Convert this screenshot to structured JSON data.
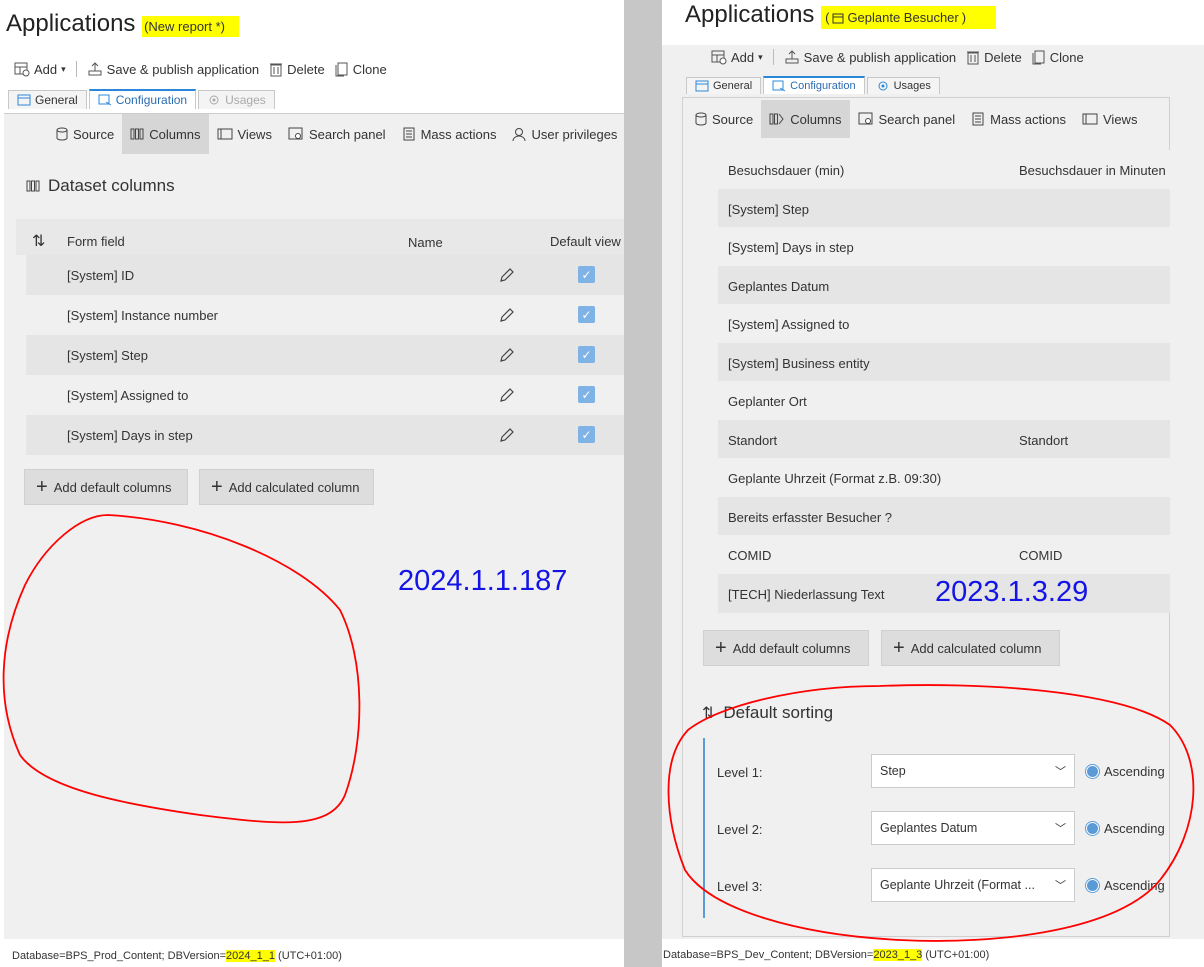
{
  "left": {
    "title": "Applications",
    "subtitle": "(New report *)",
    "toolbar": {
      "add": "Add",
      "save": "Save & publish application",
      "delete": "Delete",
      "clone": "Clone"
    },
    "tabs": {
      "general": "General",
      "configuration": "Configuration",
      "usages": "Usages"
    },
    "subnav": {
      "source": "Source",
      "columns": "Columns",
      "views": "Views",
      "search_panel": "Search panel",
      "mass_actions": "Mass actions",
      "user_privileges": "User privileges"
    },
    "section_title": "Dataset columns",
    "headers": {
      "form_field": "Form field",
      "name": "Name",
      "default_view": "Default view"
    },
    "rows": [
      {
        "field": "[System] ID"
      },
      {
        "field": "[System] Instance number"
      },
      {
        "field": "[System] Step"
      },
      {
        "field": "[System] Assigned to"
      },
      {
        "field": "[System] Days in step"
      }
    ],
    "buttons": {
      "add_default": "Add default columns",
      "add_calculated": "Add calculated column"
    },
    "version": "2024.1.1.187",
    "status": {
      "prefix": "Database=BPS_Prod_Content; DBVersion=",
      "db_version": "2024_1_1",
      "suffix": " (UTC+01:00)"
    }
  },
  "right": {
    "title": "Applications",
    "subtitle": "Geplante Besucher",
    "toolbar": {
      "add": "Add",
      "save": "Save & publish application",
      "delete": "Delete",
      "clone": "Clone"
    },
    "tabs": {
      "general": "General",
      "configuration": "Configuration",
      "usages": "Usages"
    },
    "subnav": {
      "source": "Source",
      "columns": "Columns",
      "search_panel": "Search panel",
      "mass_actions": "Mass actions",
      "views": "Views"
    },
    "rows": [
      {
        "field": "Besuchsdauer (min)",
        "name": "Besuchsdauer in Minuten"
      },
      {
        "field": "[System] Step",
        "name": ""
      },
      {
        "field": "[System] Days in step",
        "name": ""
      },
      {
        "field": "Geplantes Datum",
        "name": ""
      },
      {
        "field": "[System] Assigned to",
        "name": ""
      },
      {
        "field": "[System] Business entity",
        "name": ""
      },
      {
        "field": "Geplanter Ort",
        "name": ""
      },
      {
        "field": "Standort",
        "name": "Standort"
      },
      {
        "field": "Geplante Uhrzeit (Format z.B. 09:30)",
        "name": ""
      },
      {
        "field": "Bereits erfasster Besucher ?",
        "name": ""
      },
      {
        "field": "COMID",
        "name": "COMID"
      },
      {
        "field": "[TECH] Niederlassung Text",
        "name": ""
      }
    ],
    "buttons": {
      "add_default": "Add default columns",
      "add_calculated": "Add calculated column"
    },
    "version": "2023.1.3.29",
    "sorting": {
      "title": "Default sorting",
      "levels": [
        {
          "label": "Level 1:",
          "value": "Step",
          "order": "Ascending"
        },
        {
          "label": "Level 2:",
          "value": "Geplantes Datum",
          "order": "Ascending"
        },
        {
          "label": "Level 3:",
          "value": "Geplante Uhrzeit (Format ...",
          "order": "Ascending"
        }
      ]
    },
    "status": {
      "prefix": "Database=BPS_Dev_Content; DBVersion=",
      "db_version": "2023_1_3",
      "suffix": " (UTC+01:00)"
    }
  },
  "colors": {
    "highlight": "#ffff00",
    "annotation_red": "#ff0000",
    "version_blue": "#1414e6",
    "checkbox": "#7fb2e5"
  }
}
